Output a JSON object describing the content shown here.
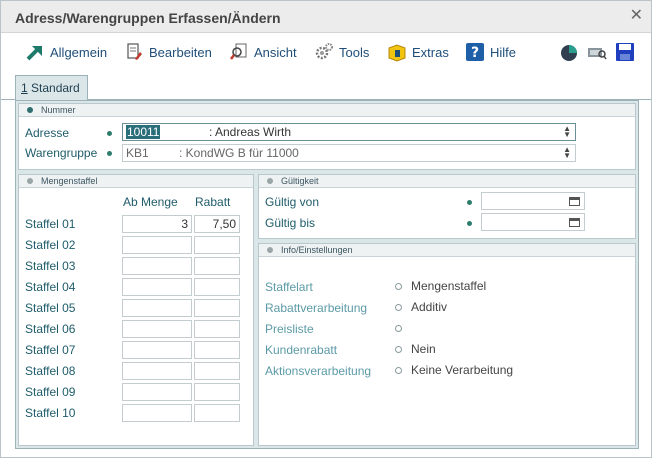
{
  "window": {
    "title": "Adress/Warengruppen Erfassen/Ändern",
    "close_glyph": "✕"
  },
  "toolbar": {
    "items": [
      {
        "label": "Allgemein",
        "icon": "arrow-icon"
      },
      {
        "label": "Bearbeiten",
        "icon": "edit-document-icon"
      },
      {
        "label": "Ansicht",
        "icon": "magnifier-icon"
      },
      {
        "label": "Tools",
        "icon": "gears-icon"
      },
      {
        "label": "Extras",
        "icon": "extras-icon"
      },
      {
        "label": "Hilfe",
        "icon": "help-icon"
      }
    ],
    "right_icons": [
      "pie-chart-icon",
      "print-preview-icon",
      "save-icon"
    ]
  },
  "tabs": [
    {
      "underline": "1",
      "label": " Standard"
    }
  ],
  "nummer": {
    "header": "Nummer",
    "adresse_label": "Adresse",
    "adresse_code": "10011",
    "adresse_name": ": Andreas Wirth",
    "warengruppe_label": "Warengruppe",
    "warengruppe_code": "KB1",
    "warengruppe_name": ": KondWG B für 11000"
  },
  "mengenstaffel": {
    "header": "Mengenstaffel",
    "col_ab_menge": "Ab Menge",
    "col_rabatt": "Rabatt",
    "rows": [
      {
        "label": "Staffel 01",
        "menge": "3",
        "rabatt": "7,50"
      },
      {
        "label": "Staffel 02",
        "menge": "",
        "rabatt": ""
      },
      {
        "label": "Staffel 03",
        "menge": "",
        "rabatt": ""
      },
      {
        "label": "Staffel 04",
        "menge": "",
        "rabatt": ""
      },
      {
        "label": "Staffel 05",
        "menge": "",
        "rabatt": ""
      },
      {
        "label": "Staffel 06",
        "menge": "",
        "rabatt": ""
      },
      {
        "label": "Staffel 07",
        "menge": "",
        "rabatt": ""
      },
      {
        "label": "Staffel 08",
        "menge": "",
        "rabatt": ""
      },
      {
        "label": "Staffel 09",
        "menge": "",
        "rabatt": ""
      },
      {
        "label": "Staffel 10",
        "menge": "",
        "rabatt": ""
      }
    ]
  },
  "gueltigkeit": {
    "header": "Gültigkeit",
    "von_label": "Gültig von",
    "von_value": "",
    "bis_label": "Gültig bis",
    "bis_value": ""
  },
  "info": {
    "header": "Info/Einstellungen",
    "rows": [
      {
        "label": "Staffelart",
        "value": "Mengenstaffel"
      },
      {
        "label": "Rabattverarbeitung",
        "value": "Additiv"
      },
      {
        "label": "Preisliste",
        "value": ""
      },
      {
        "label": "Kundenrabatt",
        "value": "Nein"
      },
      {
        "label": "Aktionsverarbeitung",
        "value": "Keine Verarbeitung"
      }
    ]
  },
  "colors": {
    "accent": "#2a6e7a",
    "label_text": "#1f5c6a",
    "toolbar_text": "#1f4e79",
    "panel_bg": "#dbe6e9"
  }
}
